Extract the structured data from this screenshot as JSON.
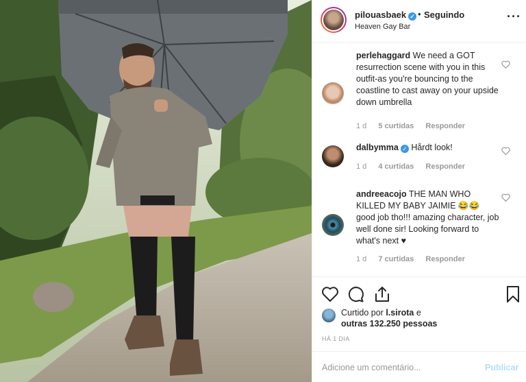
{
  "post": {
    "username": "pilouasbaek",
    "separator": "•",
    "follow_status": "Seguindo",
    "location": "Heaven Gay Bar",
    "more_icon": "more-horizontal-icon"
  },
  "comments": [
    {
      "username": "perlehaggard",
      "text": "We need a GOT resurrection scene with you in this outfit-as you're bouncing to the coastline to cast away on your upside down umbrella",
      "age": "1 d",
      "likes": "5 curtidas",
      "reply": "Responder"
    },
    {
      "username": "dalbymma",
      "verified": true,
      "text": "Hårdt look!",
      "age": "1 d",
      "likes": "4 curtidas",
      "reply": "Responder"
    },
    {
      "username": "andreeacojo",
      "text": "THE MAN WHO KILLED MY BABY JAIMIE 😂😂 good job tho!!! amazing character, job well done sir! Looking forward to what's next ♥",
      "age": "1 d",
      "likes": "7 curtidas",
      "reply": "Responder"
    }
  ],
  "liked_by": {
    "prefix": "Curtido por",
    "user": "l.sirota",
    "joiner": "e",
    "others": "outras 132.250 pessoas"
  },
  "timestamp": "HÁ 1 DIA",
  "composer": {
    "placeholder": "Adicione um comentário...",
    "submit_label": "Publicar"
  },
  "colors": {
    "accent_blue": "#3897f0",
    "disabled_blue": "#b2dffc",
    "muted_text": "#999999"
  }
}
